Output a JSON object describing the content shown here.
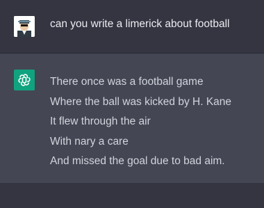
{
  "conversation": {
    "user_message": {
      "avatar_icon": "user-avatar-icon",
      "text": "can you write a limerick about football"
    },
    "assistant_message": {
      "avatar_icon": "openai-logo-icon",
      "lines": [
        "There once was a football game",
        "Where the ball was kicked by H. Kane",
        "It flew through the air",
        "With nary a care",
        "And missed the goal due to bad aim."
      ]
    }
  },
  "colors": {
    "background": "#343541",
    "assistant_background": "#444654",
    "accent": "#10a37f",
    "text": "#ececf1"
  }
}
